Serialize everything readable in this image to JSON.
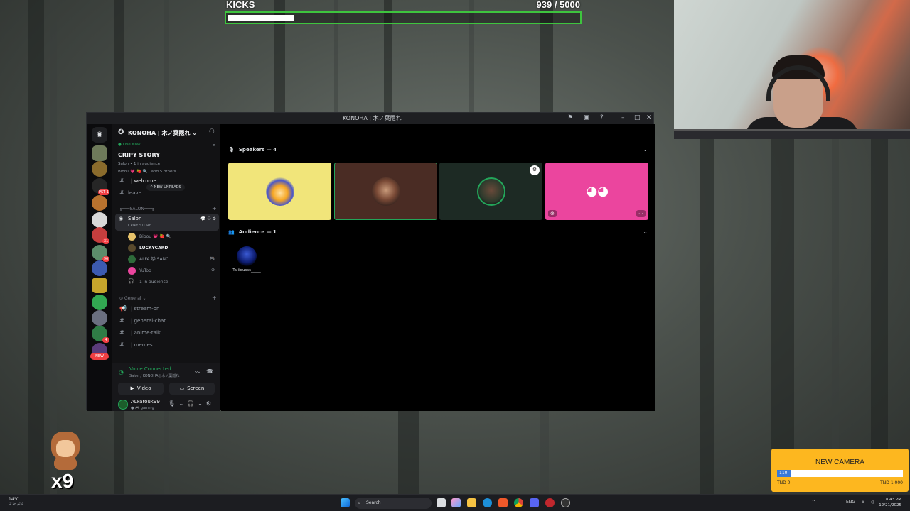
{
  "overlay": {
    "kicks_label": "KICKS",
    "kicks_count": "939",
    "kicks_total": "/ 5000",
    "kicks_progress": 0.188,
    "multiplier": "x9",
    "new_camera": {
      "title": "NEW CAMERA",
      "current": "110",
      "progress": 0.11,
      "min_label": "TND 0",
      "max_label": "TND 1,000"
    }
  },
  "window": {
    "title": "KONOHA | 木ノ葉隠れ"
  },
  "server": {
    "name": "KONOHA | 木ノ葉隠れ",
    "badges": [
      "",
      "",
      "PST 1",
      "",
      "",
      "31",
      "",
      "96",
      "",
      "",
      "",
      "4",
      "NEW"
    ]
  },
  "live_now": {
    "label": "Live Now",
    "title": "CRIPY STORY",
    "sub": "Salon • 1 in audience",
    "users": "Bibou 💗 🍓 🔍 , and 5 others"
  },
  "channels": {
    "welcome": "| welcome",
    "tooltip": "NEW UNREADS",
    "leave": "leave",
    "salon_category": "╔═══SALON═══╗",
    "salon": {
      "name": "Salon",
      "topic": "CRIPY STORY"
    },
    "voice_users": [
      {
        "name": "Bibou 💗 🍓 🔍",
        "bright": false,
        "color": "#e5c7ff",
        "icon": ""
      },
      {
        "name": "LUCKYCARD",
        "bright": true,
        "color": "#5a4a2c",
        "icon": ""
      },
      {
        "name": "ALFA 🐱 SANC",
        "bright": false,
        "color": "#2e6b3a",
        "icon": "🎮"
      },
      {
        "name": "YuToo",
        "bright": false,
        "color": "#eb459e",
        "icon": "🎙"
      },
      {
        "name": "1 in audience",
        "bright": false,
        "color": "#000000",
        "icon": ""
      }
    ],
    "general_category": "General",
    "general": [
      "| stream-on",
      "| general-chat",
      "| anime-talk",
      "| memes"
    ]
  },
  "voice_panel": {
    "status": "Voice Connected",
    "location": "Salon / KONOHA | 木ノ葉隠れ",
    "video_label": "Video",
    "screen_label": "Screen"
  },
  "user": {
    "name": "ALFarouk99",
    "status": "gaming"
  },
  "stage": {
    "speakers_label": "Speakers — 4",
    "audience_label": "Audience — 1",
    "audience": [
      {
        "name": "Taliiousss_____"
      }
    ]
  },
  "taskbar": {
    "temp": "14°C",
    "weather_sub": "غائم جزئيًا",
    "search_placeholder": "Search",
    "lang": "ENG",
    "time": "8:43 PM",
    "date": "12/21/2025"
  }
}
